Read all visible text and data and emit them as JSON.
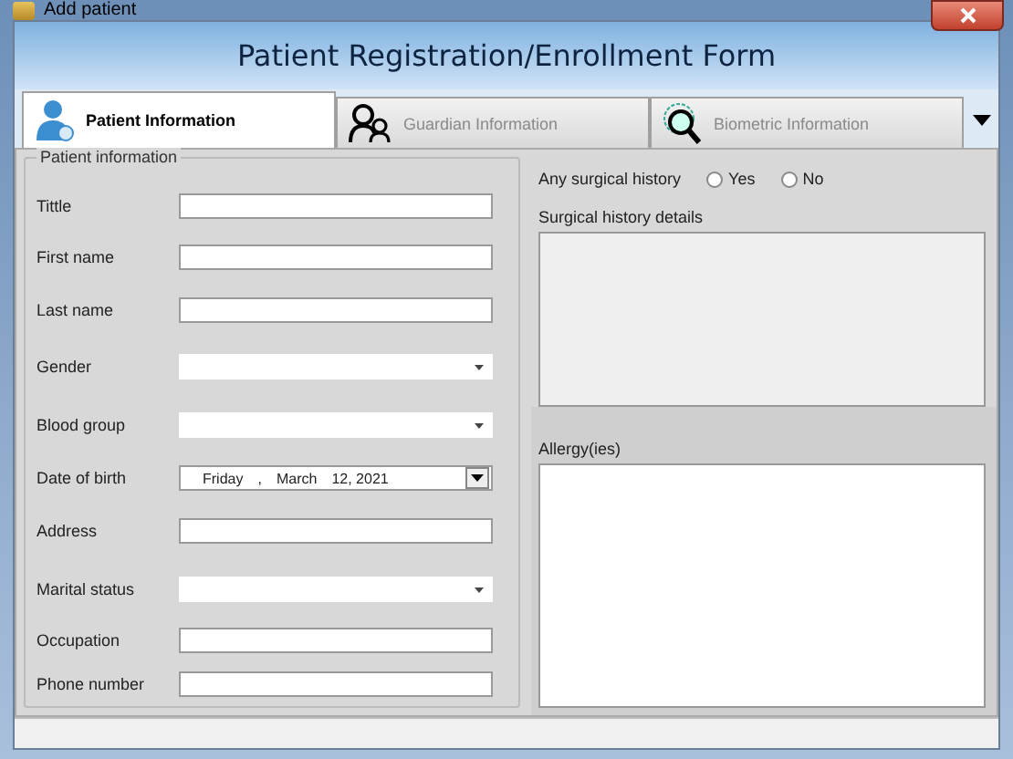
{
  "window": {
    "title": "Add patient"
  },
  "header": {
    "title": "Patient Registration/Enrollment Form"
  },
  "tabs": [
    {
      "label": "Patient Information",
      "selected": true,
      "kind": "person"
    },
    {
      "label": "Guardian Information",
      "selected": false,
      "kind": "people"
    },
    {
      "label": "Biometric Information",
      "selected": false,
      "kind": "fingerprint"
    }
  ],
  "group": {
    "title": "Patient information"
  },
  "fields": [
    {
      "label": "Tittle",
      "kind": "text"
    },
    {
      "label": "First name",
      "kind": "text"
    },
    {
      "label": "Last name",
      "kind": "text"
    },
    {
      "label": "Gender",
      "kind": "select"
    },
    {
      "label": "Blood group",
      "kind": "select"
    },
    {
      "label": "Date of birth",
      "kind": "date",
      "value_parts": [
        "Friday",
        ",",
        "March",
        "12, 2021"
      ]
    },
    {
      "label": "Address",
      "kind": "text"
    },
    {
      "label": "Marital status",
      "kind": "select"
    },
    {
      "label": "Occupation",
      "kind": "text"
    },
    {
      "label": "Phone number",
      "kind": "text"
    }
  ],
  "surgical": {
    "label": "Any surgical history",
    "options": [
      {
        "label": "Yes",
        "selected": false
      },
      {
        "label": "No",
        "selected": false
      }
    ],
    "details_label": "Surgical history details"
  },
  "allergy": {
    "label": "Allergy(ies)"
  }
}
